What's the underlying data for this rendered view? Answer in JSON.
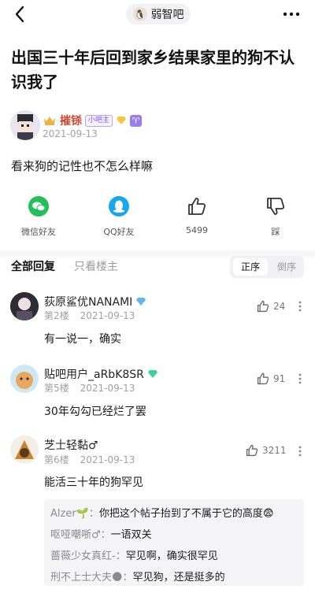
{
  "topbar": {
    "forum_name": "弱智吧"
  },
  "post": {
    "title": "出国三十年后回到家乡结果家里的狗不认识我了",
    "author": {
      "name": "摧铩",
      "badge": "小吧主",
      "date": "2021-09-13"
    },
    "body": "看来狗的记性也不怎么样嘛"
  },
  "actions": {
    "wechat": "微信好友",
    "qq": "QQ好友",
    "likes": "5499",
    "dislike": "踩"
  },
  "tabs": {
    "all": "全部回复",
    "op_only": "只看楼主"
  },
  "sort": {
    "asc": "正序",
    "desc": "倒序"
  },
  "colors": {
    "wechat": "#23c05a",
    "qq": "#19a7f0",
    "author": "#d2452f",
    "gem": "#5fb7f5"
  },
  "comments": [
    {
      "name": "荻原鲨优NANAMI",
      "floor": "第2楼",
      "date": "2021-09-13",
      "likes": "24",
      "body": "有一说一，确实"
    },
    {
      "name": "贴吧用户_aRbK8SR",
      "floor": "第5楼",
      "date": "2021-09-13",
      "likes": "91",
      "body": "30年勾勾已经烂了罢"
    },
    {
      "name": "芝士轻黏♂",
      "floor": "第6楼",
      "date": "2021-09-13",
      "likes": "3211",
      "body": "能活三十年的狗罕见"
    }
  ],
  "replies": [
    {
      "who": "Alzer🌱：",
      "text": "你把这个帖子抬到了不属于它的高度😨"
    },
    {
      "who": "呕哑嘲哳♂：",
      "text": "一语双关"
    },
    {
      "who": "蔷薇少女真红-：",
      "text": "罕见啊，确实很罕见"
    },
    {
      "who": "刑不上士大夫🌑：",
      "text": "罕见狗，还是挺多的"
    }
  ]
}
